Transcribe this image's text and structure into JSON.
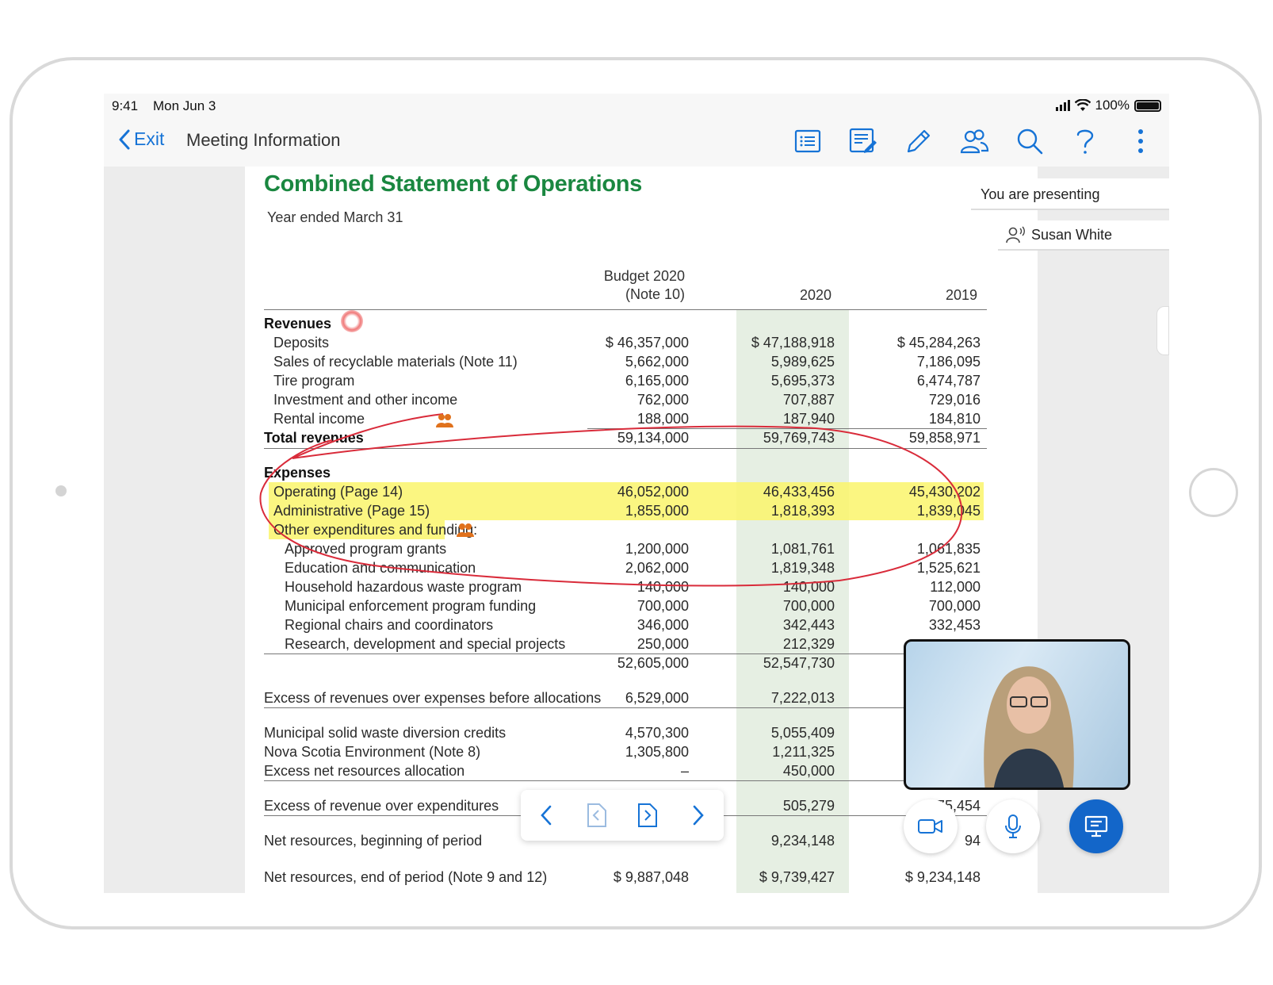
{
  "status": {
    "time": "9:41",
    "date": "Mon Jun 3",
    "battery": "100%"
  },
  "nav": {
    "back_label": "Exit",
    "title": "Meeting Information",
    "icons": [
      "agenda-list-icon",
      "notes-icon",
      "annotate-pencil-icon",
      "participants-icon",
      "search-icon",
      "help-icon",
      "more-vertical-icon"
    ]
  },
  "document": {
    "title": "Combined Statement of Operations",
    "subtitle": "Year ended March 31",
    "columns": {
      "budget_line1": "Budget 2020",
      "budget_line2": "(Note 10)",
      "y2020": "2020",
      "y2019": "2019"
    },
    "revenues_heading": "Revenues",
    "revenues": [
      {
        "label": "Deposits",
        "budget": "$ 46,357,000",
        "y2020": "$ 47,188,918",
        "y2019": "$ 45,284,263"
      },
      {
        "label": "Sales of recyclable materials (Note 11)",
        "budget": "5,662,000",
        "y2020": "5,989,625",
        "y2019": "7,186,095"
      },
      {
        "label": "Tire program",
        "budget": "6,165,000",
        "y2020": "5,695,373",
        "y2019": "6,474,787"
      },
      {
        "label": "Investment and other income",
        "budget": "762,000",
        "y2020": "707,887",
        "y2019": "729,016"
      },
      {
        "label": "Rental income",
        "budget": "188,000",
        "y2020": "187,940",
        "y2019": "184,810"
      }
    ],
    "total_revenues": {
      "label": "Total revenues",
      "budget": "59,134,000",
      "y2020": "59,769,743",
      "y2019": "59,858,971"
    },
    "expenses_heading": "Expenses",
    "expenses_top": [
      {
        "label": "Operating (Page 14)",
        "budget": "46,052,000",
        "y2020": "46,433,456",
        "y2019": "45,430,202"
      },
      {
        "label": "Administrative (Page 15)",
        "budget": "1,855,000",
        "y2020": "1,818,393",
        "y2019": "1,839,045"
      }
    ],
    "other_heading": "Other expenditures and funding:",
    "other_items": [
      {
        "label": "Approved program grants",
        "budget": "1,200,000",
        "y2020": "1,081,761",
        "y2019": "1,061,835"
      },
      {
        "label": "Education and communication",
        "budget": "2,062,000",
        "y2020": "1,819,348",
        "y2019": "1,525,621"
      },
      {
        "label": "Household hazardous waste program",
        "budget": "140,000",
        "y2020": "140,000",
        "y2019": "112,000"
      },
      {
        "label": "Municipal enforcement program funding",
        "budget": "700,000",
        "y2020": "700,000",
        "y2019": "700,000"
      },
      {
        "label": "Regional chairs and coordinators",
        "budget": "346,000",
        "y2020": "342,443",
        "y2019": "332,453"
      },
      {
        "label": "Research, development and special projects",
        "budget": "250,000",
        "y2020": "212,329",
        "y2019": ""
      }
    ],
    "total_expenses": {
      "budget": "52,605,000",
      "y2020": "52,547,730"
    },
    "excess_before": {
      "label": "Excess of revenues over expenses before allocations",
      "budget": "6,529,000",
      "y2020": "7,222,013"
    },
    "allocations": [
      {
        "label": "Municipal solid waste diversion credits",
        "budget": "4,570,300",
        "y2020": "5,055,409"
      },
      {
        "label": "Nova Scotia Environment (Note 8)",
        "budget": "1,305,800",
        "y2020": "1,211,325"
      },
      {
        "label": "Excess net resources allocation",
        "budget": "–",
        "y2020": "450,000"
      }
    ],
    "excess_over": {
      "label": "Excess of revenue over expenditures",
      "y2020": "505,279",
      "y2019": "875,454"
    },
    "net_beginning": {
      "label": "Net resources, beginning of period",
      "y2020": "9,234,148",
      "y2019": "94"
    },
    "net_end": {
      "label": "Net resources, end of period (Note 9 and 12)",
      "budget": "$ 9,887,048",
      "y2020": "$ 9,739,427",
      "y2019": "$ 9,234,148"
    }
  },
  "presentation": {
    "presenting_label": "You are presenting",
    "presenter_name": "Susan White"
  },
  "controls": {
    "pager": [
      "previous-page-icon",
      "first-page-icon",
      "last-page-icon",
      "next-page-icon"
    ],
    "call": [
      "video-camera-icon",
      "microphone-icon",
      "presentation-screen-icon"
    ]
  },
  "colors": {
    "accent": "#1673d6",
    "title_green": "#1a8740",
    "highlight": "#faf56b",
    "ink": "#d92b3a",
    "column_shade": "#e6efe3",
    "present_button": "#1366c9"
  }
}
